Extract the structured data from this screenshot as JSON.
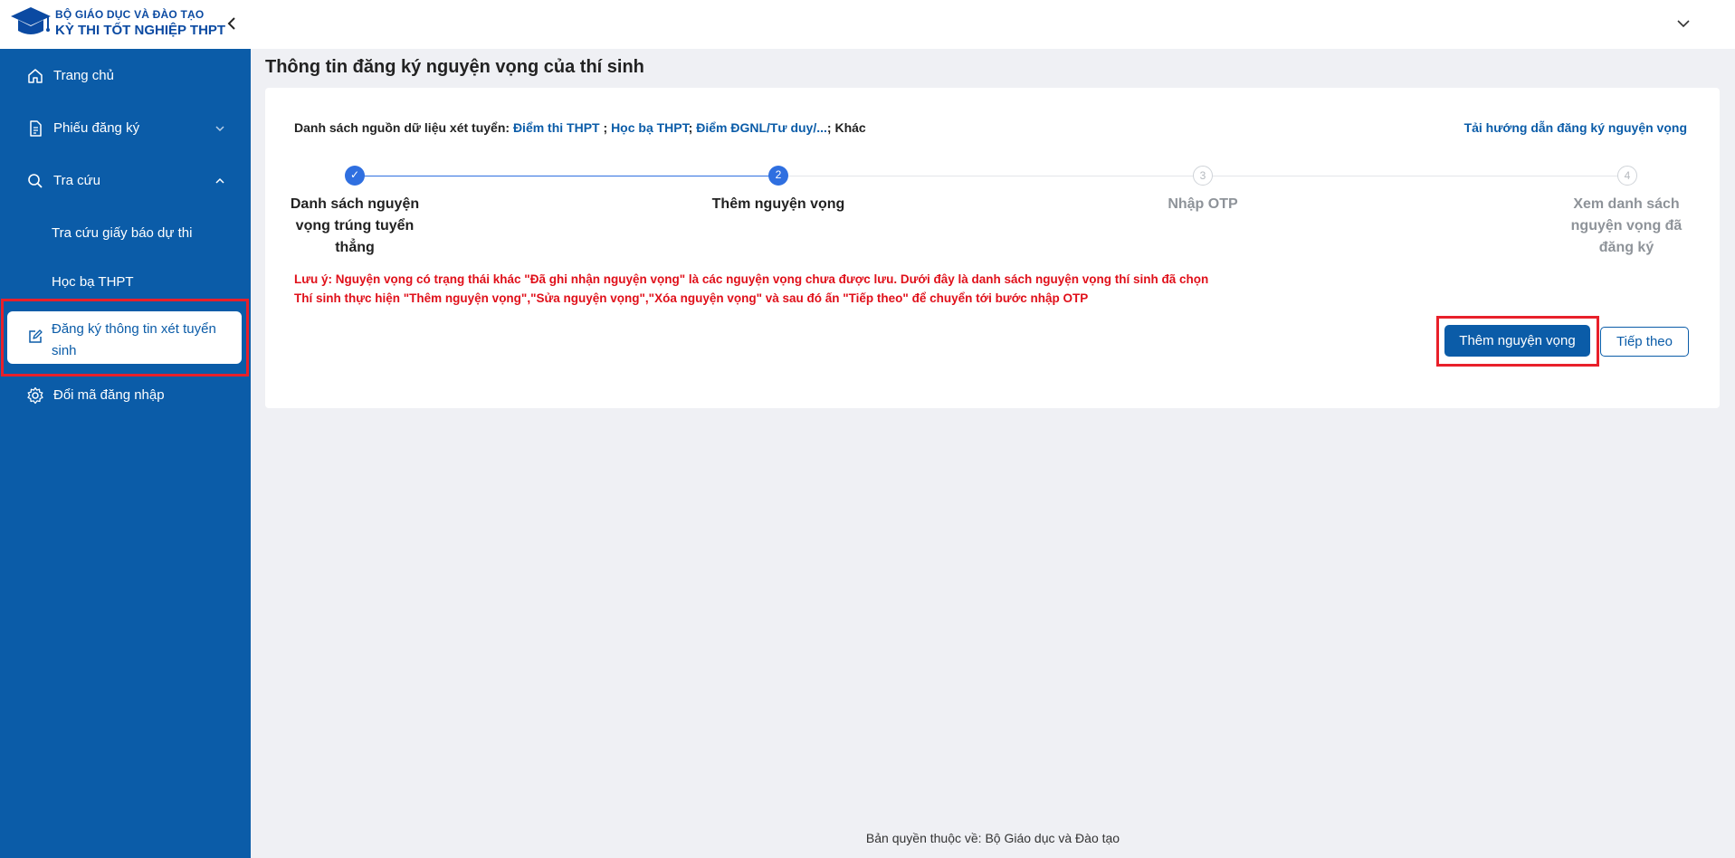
{
  "header": {
    "brand_line1": "BỘ GIÁO DỤC VÀ ĐÀO TẠO",
    "brand_line2": "KỲ THI TỐT NGHIỆP THPT"
  },
  "sidebar": {
    "items": [
      {
        "label": "Trang chủ",
        "icon": "home-icon"
      },
      {
        "label": "Phiếu đăng ký",
        "icon": "document-icon"
      },
      {
        "label": "Tra cứu",
        "icon": "search-icon"
      },
      {
        "label": "Tra cứu giấy báo dự thi"
      },
      {
        "label": "Học bạ THPT"
      },
      {
        "label": "Đăng ký thông tin xét tuyển sinh",
        "icon": "edit-icon"
      },
      {
        "label": "Đổi mã đăng nhập",
        "icon": "gear-icon"
      }
    ]
  },
  "main": {
    "title": "Thông tin đăng ký nguyện vọng của thí sinh",
    "sources_prefix": "Danh sách nguồn dữ liệu xét tuyển: ",
    "sources": [
      "Điểm thi THPT",
      "Học bạ THPT",
      "Điểm ĐGNL/Tư duy/..."
    ],
    "sep1": " ; ",
    "sep2": "; ",
    "sep3": "; ",
    "sources_other": "Khác",
    "guide_link": "Tải hướng dẫn đăng ký nguyện vọng",
    "steps": [
      {
        "number": "✓",
        "label": "Danh sách nguyện vọng trúng tuyển thẳng",
        "status": "done"
      },
      {
        "number": "2",
        "label": "Thêm nguyện vọng",
        "status": "current"
      },
      {
        "number": "3",
        "label": "Nhập OTP",
        "status": "pending"
      },
      {
        "number": "4",
        "label": "Xem danh sách nguyện vọng đã đăng ký",
        "status": "pending"
      }
    ],
    "note_line1": "Lưu ý: Nguyện vọng có trạng thái khác \"Đã ghi nhận nguyện vọng\" là các nguyện vọng chưa được lưu. Dưới đây là danh sách nguyện vọng thí sinh đã chọn",
    "note_line2": "Thí sinh thực hiện \"Thêm nguyện vọng\",\"Sửa nguyện vọng\",\"Xóa nguyện vọng\" và sau đó ấn \"Tiếp theo\" để chuyển tới bước nhập OTP",
    "add_button": "Thêm nguyện vọng",
    "next_button": "Tiếp theo"
  },
  "footer": {
    "copyright": "Bản quyền thuộc về: Bộ Giáo dục và Đào tạo"
  },
  "colors": {
    "primary": "#0b5ca8",
    "step_active": "#2f6fe0",
    "highlight": "#e8202a",
    "note": "#e0101a"
  }
}
